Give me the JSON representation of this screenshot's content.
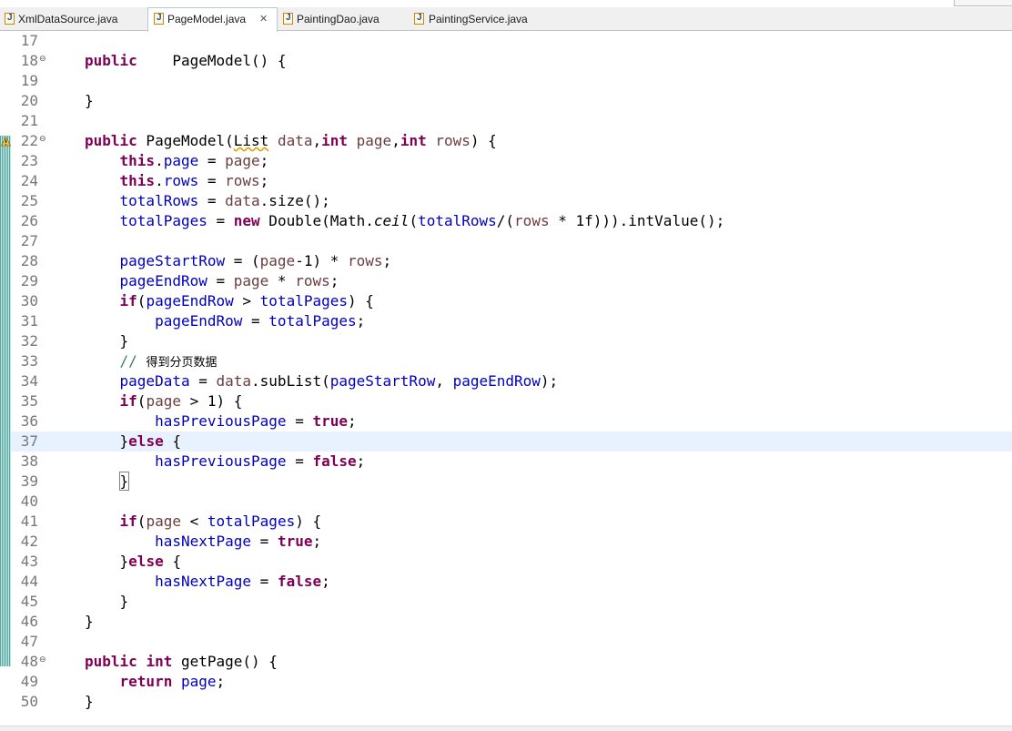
{
  "tabs": [
    {
      "label": "XmlDataSource.java",
      "active": false,
      "icon": "java-file-icon"
    },
    {
      "label": "PageModel.java",
      "active": true,
      "icon": "java-file-icon",
      "close": "✕"
    },
    {
      "label": "PaintingDao.java",
      "active": false,
      "icon": "java-interface-icon"
    },
    {
      "label": "PaintingService.java",
      "active": false,
      "icon": "java-interface-icon"
    }
  ],
  "editor": {
    "current_line": "37",
    "lines": [
      {
        "n": "17",
        "fold": false,
        "tokens": []
      },
      {
        "n": "18",
        "fold": true,
        "tokens": [
          [
            "kw",
            "public"
          ],
          [
            "",
            "    "
          ],
          [
            "",
            "PageModel() {"
          ]
        ]
      },
      {
        "n": "19",
        "fold": false,
        "tokens": []
      },
      {
        "n": "20",
        "fold": false,
        "tokens": [
          [
            "",
            "}"
          ]
        ]
      },
      {
        "n": "21",
        "fold": false,
        "tokens": []
      },
      {
        "n": "22",
        "fold": true,
        "tokens": [
          [
            "kw",
            "public"
          ],
          [
            "",
            " PageModel("
          ],
          [
            "sq",
            "List"
          ],
          [
            "",
            " "
          ],
          [
            "lv",
            "data"
          ],
          [
            "",
            ","
          ],
          [
            "kw",
            "int"
          ],
          [
            "",
            " "
          ],
          [
            "lv",
            "page"
          ],
          [
            "",
            ","
          ],
          [
            "kw",
            "int"
          ],
          [
            "",
            " "
          ],
          [
            "lv",
            "rows"
          ],
          [
            "",
            ") {"
          ]
        ]
      },
      {
        "n": "23",
        "fold": false,
        "tokens": [
          [
            "",
            "    "
          ],
          [
            "kw",
            "this"
          ],
          [
            "",
            "."
          ],
          [
            "fd",
            "page"
          ],
          [
            "",
            " = "
          ],
          [
            "lv",
            "page"
          ],
          [
            "",
            ";"
          ]
        ]
      },
      {
        "n": "24",
        "fold": false,
        "tokens": [
          [
            "",
            "    "
          ],
          [
            "kw",
            "this"
          ],
          [
            "",
            "."
          ],
          [
            "fd",
            "rows"
          ],
          [
            "",
            " = "
          ],
          [
            "lv",
            "rows"
          ],
          [
            "",
            ";"
          ]
        ]
      },
      {
        "n": "25",
        "fold": false,
        "tokens": [
          [
            "",
            "    "
          ],
          [
            "fd",
            "totalRows"
          ],
          [
            "",
            " = "
          ],
          [
            "lv",
            "data"
          ],
          [
            "",
            ".size();"
          ]
        ]
      },
      {
        "n": "26",
        "fold": false,
        "tokens": [
          [
            "",
            "    "
          ],
          [
            "fd",
            "totalPages"
          ],
          [
            "",
            " = "
          ],
          [
            "kw",
            "new"
          ],
          [
            "",
            " Double(Math."
          ],
          [
            "it",
            "ceil"
          ],
          [
            "",
            "("
          ],
          [
            "fd",
            "totalRows"
          ],
          [
            "",
            "/("
          ],
          [
            "lv",
            "rows"
          ],
          [
            "",
            " * 1f))).intValue();"
          ]
        ]
      },
      {
        "n": "27",
        "fold": false,
        "tokens": []
      },
      {
        "n": "28",
        "fold": false,
        "tokens": [
          [
            "",
            "    "
          ],
          [
            "fd",
            "pageStartRow"
          ],
          [
            "",
            " = ("
          ],
          [
            "lv",
            "page"
          ],
          [
            "",
            "-1) * "
          ],
          [
            "lv",
            "rows"
          ],
          [
            "",
            ";"
          ]
        ]
      },
      {
        "n": "29",
        "fold": false,
        "tokens": [
          [
            "",
            "    "
          ],
          [
            "fd",
            "pageEndRow"
          ],
          [
            "",
            " = "
          ],
          [
            "lv",
            "page"
          ],
          [
            "",
            " * "
          ],
          [
            "lv",
            "rows"
          ],
          [
            "",
            ";"
          ]
        ]
      },
      {
        "n": "30",
        "fold": false,
        "tokens": [
          [
            "",
            "    "
          ],
          [
            "kw",
            "if"
          ],
          [
            "",
            "("
          ],
          [
            "fd",
            "pageEndRow"
          ],
          [
            "",
            " > "
          ],
          [
            "fd",
            "totalPages"
          ],
          [
            "",
            ") {"
          ]
        ]
      },
      {
        "n": "31",
        "fold": false,
        "tokens": [
          [
            "",
            "        "
          ],
          [
            "fd",
            "pageEndRow"
          ],
          [
            "",
            " = "
          ],
          [
            "fd",
            "totalPages"
          ],
          [
            "",
            ";"
          ]
        ]
      },
      {
        "n": "32",
        "fold": false,
        "tokens": [
          [
            "",
            "    }"
          ]
        ]
      },
      {
        "n": "33",
        "fold": false,
        "tokens": [
          [
            "",
            "    "
          ],
          [
            "cm",
            "// "
          ],
          [
            "cm-cjk",
            "得到分页数据"
          ]
        ]
      },
      {
        "n": "34",
        "fold": false,
        "tokens": [
          [
            "",
            "    "
          ],
          [
            "fd",
            "pageData"
          ],
          [
            "",
            " = "
          ],
          [
            "lv",
            "data"
          ],
          [
            "",
            ".subList("
          ],
          [
            "fd",
            "pageStartRow"
          ],
          [
            "",
            ", "
          ],
          [
            "fd",
            "pageEndRow"
          ],
          [
            "",
            ");"
          ]
        ]
      },
      {
        "n": "35",
        "fold": false,
        "tokens": [
          [
            "",
            "    "
          ],
          [
            "kw",
            "if"
          ],
          [
            "",
            "("
          ],
          [
            "lv",
            "page"
          ],
          [
            "",
            " > 1) {"
          ]
        ]
      },
      {
        "n": "36",
        "fold": false,
        "tokens": [
          [
            "",
            "        "
          ],
          [
            "fd",
            "hasPreviousPage"
          ],
          [
            "",
            " = "
          ],
          [
            "kw",
            "true"
          ],
          [
            "",
            ";"
          ]
        ]
      },
      {
        "n": "37",
        "fold": false,
        "tokens": [
          [
            "",
            "    }"
          ],
          [
            "kw",
            "else"
          ],
          [
            "",
            " {"
          ]
        ]
      },
      {
        "n": "38",
        "fold": false,
        "tokens": [
          [
            "",
            "        "
          ],
          [
            "fd",
            "hasPreviousPage"
          ],
          [
            "",
            " = "
          ],
          [
            "kw",
            "false"
          ],
          [
            "",
            ";"
          ]
        ]
      },
      {
        "n": "39",
        "fold": false,
        "tokens": [
          [
            "",
            "    "
          ],
          [
            "bm",
            "}"
          ]
        ]
      },
      {
        "n": "40",
        "fold": false,
        "tokens": []
      },
      {
        "n": "41",
        "fold": false,
        "tokens": [
          [
            "",
            "    "
          ],
          [
            "kw",
            "if"
          ],
          [
            "",
            "("
          ],
          [
            "lv",
            "page"
          ],
          [
            "",
            " < "
          ],
          [
            "fd",
            "totalPages"
          ],
          [
            "",
            ") {"
          ]
        ]
      },
      {
        "n": "42",
        "fold": false,
        "tokens": [
          [
            "",
            "        "
          ],
          [
            "fd",
            "hasNextPage"
          ],
          [
            "",
            " = "
          ],
          [
            "kw",
            "true"
          ],
          [
            "",
            ";"
          ]
        ]
      },
      {
        "n": "43",
        "fold": false,
        "tokens": [
          [
            "",
            "    }"
          ],
          [
            "kw",
            "else"
          ],
          [
            "",
            " {"
          ]
        ]
      },
      {
        "n": "44",
        "fold": false,
        "tokens": [
          [
            "",
            "        "
          ],
          [
            "fd",
            "hasNextPage"
          ],
          [
            "",
            " = "
          ],
          [
            "kw",
            "false"
          ],
          [
            "",
            ";"
          ]
        ]
      },
      {
        "n": "45",
        "fold": false,
        "tokens": [
          [
            "",
            "    }"
          ]
        ]
      },
      {
        "n": "46",
        "fold": false,
        "tokens": [
          [
            "",
            "}"
          ]
        ]
      },
      {
        "n": "47",
        "fold": false,
        "tokens": []
      },
      {
        "n": "48",
        "fold": true,
        "tokens": [
          [
            "kw",
            "public"
          ],
          [
            "",
            " "
          ],
          [
            "kw",
            "int"
          ],
          [
            "",
            " getPage() {"
          ]
        ]
      },
      {
        "n": "49",
        "fold": false,
        "tokens": [
          [
            "",
            "    "
          ],
          [
            "kw",
            "return"
          ],
          [
            "",
            " "
          ],
          [
            "fd",
            "page"
          ],
          [
            "",
            ";"
          ]
        ]
      },
      {
        "n": "50",
        "fold": false,
        "tokens": [
          [
            "",
            "}"
          ]
        ]
      }
    ]
  }
}
